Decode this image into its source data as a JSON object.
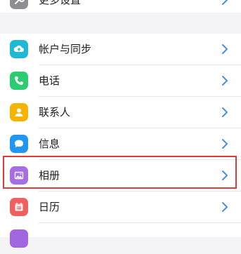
{
  "settings": {
    "top_item": {
      "label": "更多设置",
      "icon": "wrench-icon",
      "color": "#8e8e93"
    },
    "items": [
      {
        "label": "帐户与同步",
        "icon": "cloud-sync-icon",
        "color": "#1fb8d6"
      },
      {
        "label": "电话",
        "icon": "phone-icon",
        "color": "#2ecc71"
      },
      {
        "label": "联系人",
        "icon": "contact-icon",
        "color": "#f5b400"
      },
      {
        "label": "信息",
        "icon": "message-icon",
        "color": "#2196f3"
      },
      {
        "label": "相册",
        "icon": "photo-album-icon",
        "color": "#a66de5",
        "highlighted": true
      },
      {
        "label": "日历",
        "icon": "calendar-icon",
        "color": "#f06060"
      }
    ],
    "partial_item": {
      "icon": "unknown-app-icon",
      "color": "#a066e0"
    }
  },
  "colors": {
    "chevron": "#4a90d9",
    "highlight": "#e53935"
  }
}
